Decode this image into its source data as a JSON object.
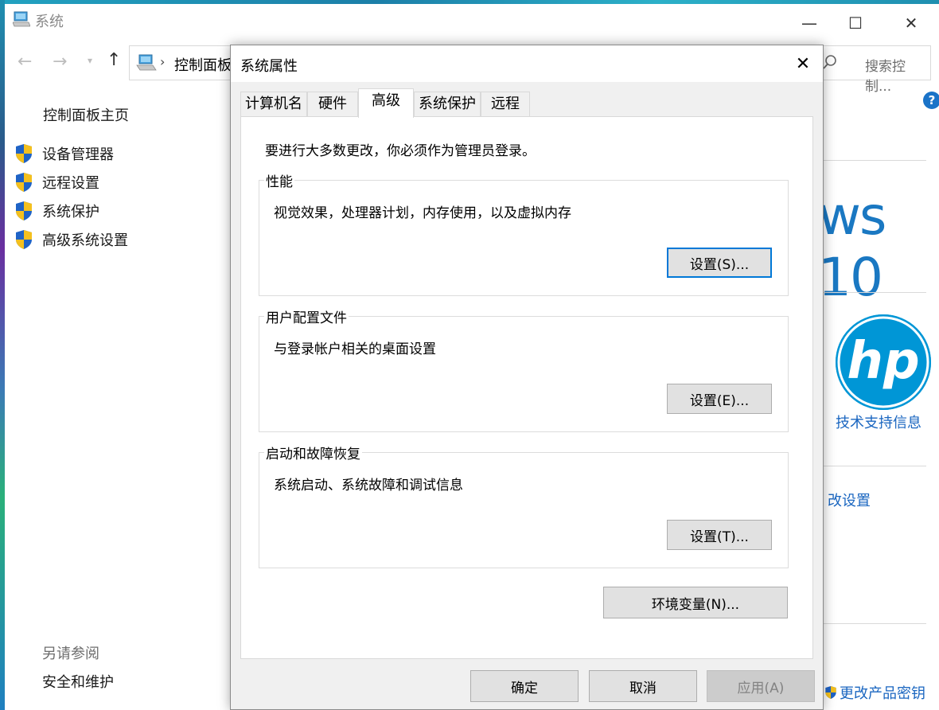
{
  "window": {
    "title": "系统",
    "minimize_glyph": "—",
    "maximize_glyph": "☐",
    "close_glyph": "✕"
  },
  "toolbar": {
    "back_glyph": "←",
    "forward_glyph": "→",
    "recent_glyph": "⌄",
    "up_glyph": "↑",
    "breadcrumb_sep": "›",
    "address_text": "控制面板",
    "search_placeholder": "搜索控制..."
  },
  "sidebar": {
    "home": "控制面板主页",
    "items": [
      {
        "label": "设备管理器",
        "icon": "uac-shield-icon"
      },
      {
        "label": "远程设置",
        "icon": "uac-shield-icon"
      },
      {
        "label": "系统保护",
        "icon": "uac-shield-icon"
      },
      {
        "label": "高级系统设置",
        "icon": "uac-shield-icon"
      }
    ],
    "see_also": "另请参阅",
    "security_link": "安全和维护"
  },
  "right_panel": {
    "windows_logo_text": "ws 10",
    "hp_support": "技术支持信息",
    "change_settings": "改设置",
    "change_product_key": "更改产品密钥",
    "help_glyph": "?"
  },
  "dialog": {
    "title": "系统属性",
    "close_glyph": "✕",
    "tabs": [
      "计算机名",
      "硬件",
      "高级",
      "系统保护",
      "远程"
    ],
    "active_tab": "高级",
    "admin_note": "要进行大多数更改，你必须作为管理员登录。",
    "groups": [
      {
        "title": "性能",
        "desc": "视觉效果，处理器计划，内存使用，以及虚拟内存",
        "button": "设置(S)..."
      },
      {
        "title": "用户配置文件",
        "desc": "与登录帐户相关的桌面设置",
        "button": "设置(E)..."
      },
      {
        "title": "启动和故障恢复",
        "desc": "系统启动、系统故障和调试信息",
        "button": "设置(T)..."
      }
    ],
    "env_button": "环境变量(N)...",
    "ok": "确定",
    "cancel": "取消",
    "apply": "应用(A)"
  },
  "colors": {
    "accent_blue": "#0078d7",
    "link_blue": "#1a66c0",
    "hp_blue": "#0096d6",
    "dialog_bg": "#f0f0f0"
  }
}
